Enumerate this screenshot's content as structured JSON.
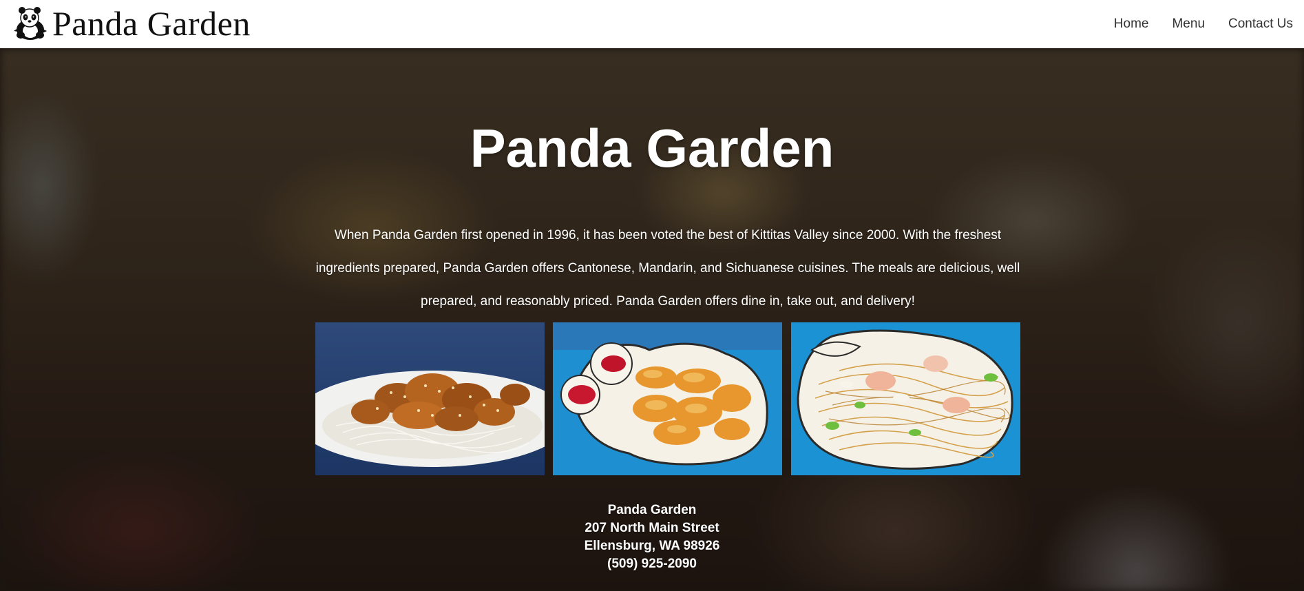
{
  "header": {
    "logo_text": "Panda Garden",
    "logo_icon": "panda-icon",
    "nav": [
      {
        "label": "Home"
      },
      {
        "label": "Menu"
      },
      {
        "label": "Contact Us"
      }
    ]
  },
  "hero": {
    "title": "Panda Garden",
    "intro": "When Panda Garden first opened in 1996, it has been voted the best of Kittitas Valley since 2000. With the freshest ingredients prepared, Panda Garden offers Cantonese, Mandarin, and Sichuanese cuisines. The meals are delicious, well prepared, and reasonably priced. Panda Garden offers dine in, take out, and delivery!"
  },
  "gallery": [
    {
      "name": "sesame-chicken-photo"
    },
    {
      "name": "fried-shrimp-photo"
    },
    {
      "name": "lo-mein-photo"
    }
  ],
  "address": {
    "name": "Panda Garden",
    "street": "207 North Main Street",
    "city": "Ellensburg, WA 98926",
    "phone": "(509) 925-2090"
  },
  "colors": {
    "header_bg": "#ffffff",
    "nav_text": "#333333",
    "hero_text": "#ffffff",
    "plate_blue": "#1e8fd0"
  }
}
